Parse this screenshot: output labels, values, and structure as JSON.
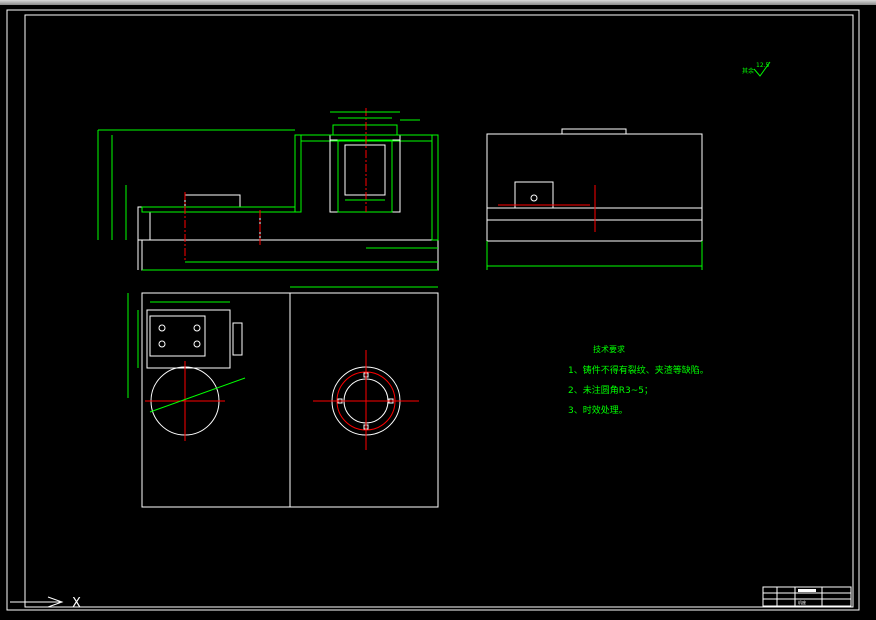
{
  "app": {
    "name": "AutoCAD drawing viewport"
  },
  "colors": {
    "background": "#000000",
    "line": "#ffffff",
    "dimension": "#00ff00",
    "centerline": "#ff0000",
    "note_text": "#00ff00"
  },
  "drawing": {
    "roughness_symbol": {
      "prefix": "其余",
      "value": "12.5"
    },
    "technical_requirements": {
      "title": "技术要求",
      "items": [
        "1、铸件不得有裂纹、夹渣等缺陷。",
        "2、未注圆角R3~5；",
        "3、时效处理。"
      ]
    },
    "title_block": {
      "drawing_name": "机座"
    }
  },
  "ucs_icon": {
    "name": "ucs-icon",
    "axis_label": "X"
  }
}
